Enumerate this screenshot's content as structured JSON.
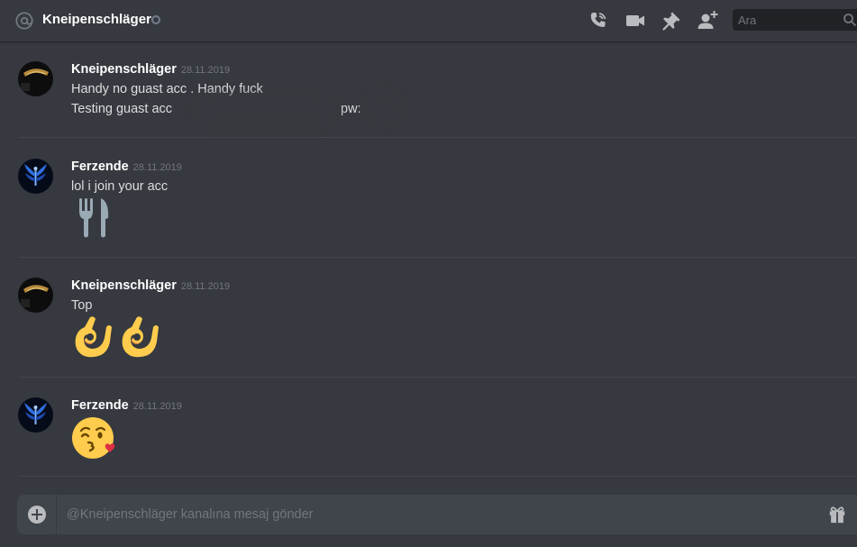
{
  "header": {
    "dm_name": "Kneipenschläger",
    "search_placeholder": "Ara"
  },
  "messages": [
    {
      "author": "Kneipenschläger",
      "timestamp": "28.11.2019",
      "lines": [
        "Handy no guast acc . Handy fuck",
        "Testing guast acc",
        "pw:"
      ]
    },
    {
      "author": "Ferzende",
      "timestamp": "28.11.2019",
      "lines": [
        "lol i join your acc"
      ],
      "emoji": [
        "fork-and-knife"
      ]
    },
    {
      "author": "Kneipenschläger",
      "timestamp": "28.11.2019",
      "lines": [
        "Top"
      ],
      "emoji": [
        "ok-hand",
        "ok-hand"
      ]
    },
    {
      "author": "Ferzende",
      "timestamp": "28.11.2019",
      "lines": [],
      "emoji": [
        "face-blowing-kiss"
      ]
    }
  ],
  "composer": {
    "placeholder": "@Kneipenschläger kanalına mesaj gönder"
  },
  "colors": {
    "background": "#36393f",
    "input_bg": "#40444b",
    "header_icons": "#b9bbbe",
    "username": "#ffffff",
    "timestamp": "#72767d"
  }
}
